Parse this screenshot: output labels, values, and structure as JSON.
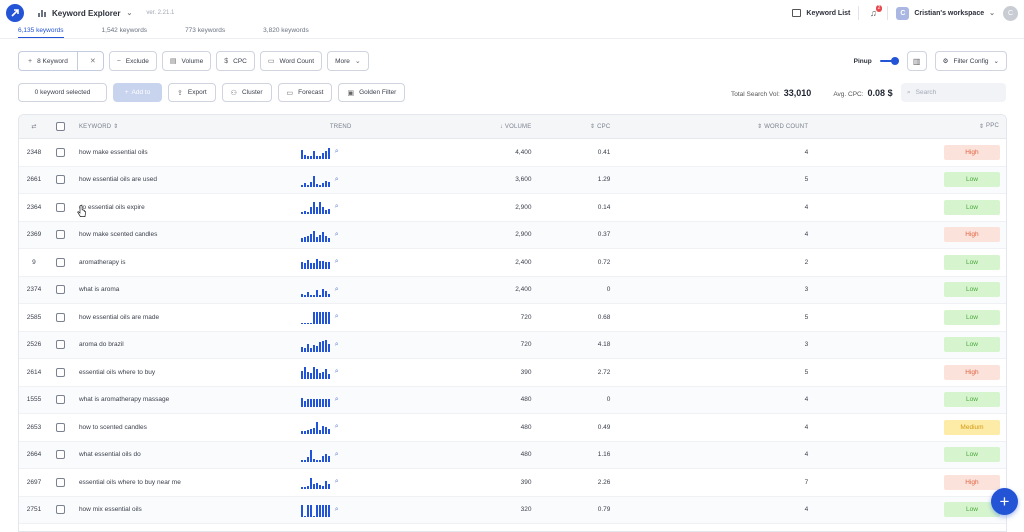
{
  "header": {
    "app_title": "Keyword Explorer",
    "version": "ver. 2.21.1",
    "keyword_list": "Keyword List",
    "notification_count": "2",
    "workspace_initial": "C",
    "workspace": "Cristian's workspace",
    "avatar_initial": "C"
  },
  "tabs": [
    {
      "label": "6,135 keywords",
      "active": true
    },
    {
      "label": "1,542 keywords",
      "active": false
    },
    {
      "label": "773 keywords",
      "active": false
    },
    {
      "label": "3,820 keywords",
      "active": false
    }
  ],
  "filters": {
    "keyword": "8 Keyword",
    "exclude": "Exclude",
    "volume": "Volume",
    "cpc": "CPC",
    "word_count": "Word Count",
    "more": "More",
    "pinup": "Pinup",
    "filter_config": "Filter Config"
  },
  "actions": {
    "keyword_selected": "0 keyword selected",
    "add_to": "Add to",
    "export": "Export",
    "cluster": "Cluster",
    "forecast": "Forecast",
    "golden_filter": "Golden Filter",
    "total_label": "Total Search Vol:",
    "total_value": "33,010",
    "avg_label": "Avg. CPC:",
    "avg_value": "0.08 $",
    "search_placeholder": "Search"
  },
  "columns": {
    "keyword": "KEYWORD",
    "trend": "TREND",
    "volume": "VOLUME",
    "cpc": "CPC",
    "word_count": "WORD COUNT",
    "ppc": "PPC"
  },
  "colors": {
    "accent": "#2454d6",
    "high": "#e0603e",
    "low": "#4aa63c",
    "medium": "#d49a12"
  },
  "rows": [
    {
      "id": "2348",
      "keyword": "how make essential oils",
      "volume": "4,400",
      "cpc": "0.41",
      "word_count": "4",
      "ppc": "High",
      "level": "high",
      "trend": [
        9,
        4,
        3,
        3,
        8,
        3,
        3,
        6,
        8,
        11
      ]
    },
    {
      "id": "2661",
      "keyword": "how essential oils are used",
      "volume": "3,600",
      "cpc": "1.29",
      "word_count": "5",
      "ppc": "Low",
      "level": "low",
      "trend": [
        2,
        4,
        2,
        5,
        11,
        3,
        2,
        4,
        6,
        5
      ]
    },
    {
      "id": "2364",
      "keyword": "do essential oils expire",
      "volume": "2,900",
      "cpc": "0.14",
      "word_count": "4",
      "ppc": "Low",
      "level": "low",
      "trend": [
        2,
        3,
        2,
        7,
        12,
        7,
        12,
        7,
        4,
        5
      ]
    },
    {
      "id": "2369",
      "keyword": "how make scented candles",
      "volume": "2,900",
      "cpc": "0.37",
      "word_count": "4",
      "ppc": "High",
      "level": "high",
      "trend": [
        4,
        5,
        6,
        8,
        11,
        5,
        7,
        10,
        6,
        4
      ]
    },
    {
      "id": "9",
      "keyword": "aromatherapy is",
      "volume": "2,400",
      "cpc": "0.72",
      "word_count": "2",
      "ppc": "Low",
      "level": "low",
      "trend": [
        7,
        6,
        9,
        6,
        6,
        10,
        8,
        8,
        7,
        7
      ]
    },
    {
      "id": "2374",
      "keyword": "what is aroma",
      "volume": "2,400",
      "cpc": "0",
      "word_count": "3",
      "ppc": "Low",
      "level": "low",
      "trend": [
        3,
        2,
        5,
        2,
        2,
        7,
        2,
        8,
        6,
        3
      ]
    },
    {
      "id": "2585",
      "keyword": "how essential oils are made",
      "volume": "720",
      "cpc": "0.68",
      "word_count": "5",
      "ppc": "Low",
      "level": "low",
      "trend": [
        1,
        1,
        1,
        1,
        12,
        12,
        12,
        12,
        12,
        12
      ]
    },
    {
      "id": "2526",
      "keyword": "aroma do brazil",
      "volume": "720",
      "cpc": "4.18",
      "word_count": "3",
      "ppc": "Low",
      "level": "low",
      "trend": [
        5,
        4,
        8,
        4,
        7,
        6,
        10,
        11,
        12,
        8
      ]
    },
    {
      "id": "2614",
      "keyword": "essential oils where to buy",
      "volume": "390",
      "cpc": "2.72",
      "word_count": "5",
      "ppc": "High",
      "level": "high",
      "trend": [
        8,
        12,
        7,
        6,
        12,
        10,
        6,
        7,
        10,
        5
      ]
    },
    {
      "id": "1555",
      "keyword": "what is aromatherapy massage",
      "volume": "480",
      "cpc": "0",
      "word_count": "4",
      "ppc": "Low",
      "level": "low",
      "trend": [
        9,
        6,
        8,
        8,
        8,
        8,
        8,
        8,
        8,
        8
      ]
    },
    {
      "id": "2653",
      "keyword": "how to scented candles",
      "volume": "480",
      "cpc": "0.49",
      "word_count": "4",
      "ppc": "Medium",
      "level": "medium",
      "trend": [
        3,
        3,
        4,
        5,
        6,
        12,
        4,
        8,
        7,
        5
      ]
    },
    {
      "id": "2664",
      "keyword": "what essential oils do",
      "volume": "480",
      "cpc": "1.16",
      "word_count": "4",
      "ppc": "Low",
      "level": "low",
      "trend": [
        2,
        2,
        5,
        12,
        3,
        2,
        2,
        6,
        8,
        6
      ]
    },
    {
      "id": "2697",
      "keyword": "essential oils where to buy near me",
      "volume": "390",
      "cpc": "2.26",
      "word_count": "7",
      "ppc": "High",
      "level": "high",
      "trend": [
        2,
        2,
        3,
        11,
        5,
        6,
        4,
        3,
        8,
        5
      ]
    },
    {
      "id": "2751",
      "keyword": "how mix essential oils",
      "volume": "320",
      "cpc": "0.79",
      "word_count": "4",
      "ppc": "Low",
      "level": "low",
      "trend": [
        12,
        1,
        12,
        12,
        1,
        12,
        12,
        12,
        12,
        12
      ]
    }
  ]
}
